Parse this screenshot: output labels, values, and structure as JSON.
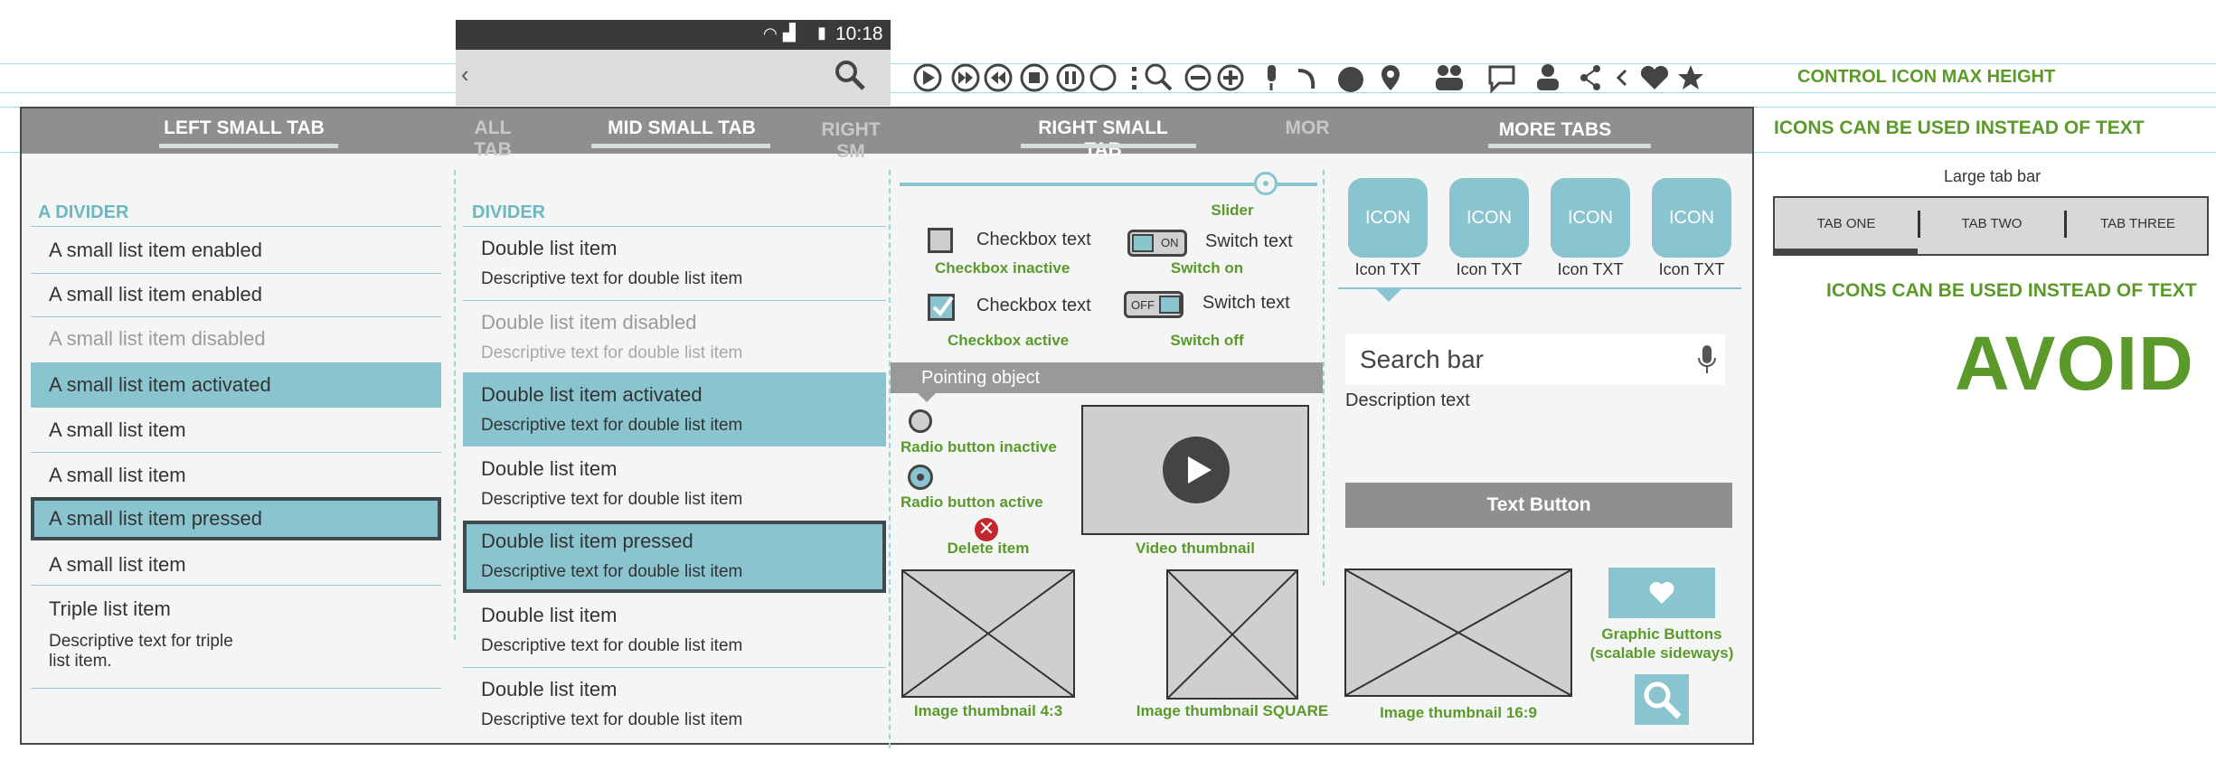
{
  "status_bar": {
    "time": "10:18"
  },
  "top_tabs": [
    {
      "label": "LEFT SMALL TAB"
    },
    {
      "label": "ALL TAB"
    },
    {
      "label": "MID SMALL TAB"
    },
    {
      "label": "RIGHT SM"
    },
    {
      "label": "RIGHT SMALL TAB"
    },
    {
      "label": "MOR"
    },
    {
      "label": "MORE TABS"
    }
  ],
  "notes": {
    "control_icon": "CONTROL ICON MAX HEIGHT",
    "icons_text_1": "ICONS CAN BE USED INSTEAD OF TEXT",
    "large_tab_bar": "Large tab bar",
    "icons_text_2": "ICONS CAN BE USED INSTEAD OF TEXT",
    "avoid": "AVOID"
  },
  "large_tabs": [
    {
      "label": "TAB ONE"
    },
    {
      "label": "TAB TWO"
    },
    {
      "label": "TAB THREE"
    }
  ],
  "left_list": {
    "divider": "A DIVIDER",
    "items": [
      {
        "label": "A small list item enabled"
      },
      {
        "label": "A small list item enabled"
      },
      {
        "label": "A small list item disabled"
      },
      {
        "label": "A small list item activated"
      },
      {
        "label": "A small list item"
      },
      {
        "label": "A small list item"
      },
      {
        "label": "A small list item pressed"
      },
      {
        "label": "A small list item"
      }
    ],
    "triple": {
      "title": "Triple list item",
      "desc1": "Descriptive text for triple",
      "desc2": "list item."
    }
  },
  "mid_list": {
    "divider": "DIVIDER",
    "items": [
      {
        "title": "Double list item",
        "desc": "Descriptive text for double list item"
      },
      {
        "title": "Double list item disabled",
        "desc": "Descriptive text for double list item"
      },
      {
        "title": "Double list item activated",
        "desc": "Descriptive text for double list item"
      },
      {
        "title": "Double list item",
        "desc": "Descriptive text for double list item"
      },
      {
        "title": "Double list item pressed",
        "desc": "Descriptive text for double list item"
      },
      {
        "title": "Double list item",
        "desc": "Descriptive text for double list item"
      },
      {
        "title": "Double list item",
        "desc": "Descriptive text for double list item"
      }
    ]
  },
  "controls": {
    "slider_label": "Slider",
    "slider_value": 0.9,
    "checkbox_text": "Checkbox text",
    "checkbox_inactive": "Checkbox inactive",
    "checkbox_active": "Checkbox active",
    "switch_text": "Switch text",
    "switch_on_badge": "ON",
    "switch_off_badge": "OFF",
    "switch_on": "Switch on",
    "switch_off": "Switch off",
    "pointing_object": "Pointing object",
    "radio_inactive": "Radio button inactive",
    "radio_active": "Radio button active",
    "delete_item": "Delete item",
    "video_thumbnail": "Video thumbnail",
    "img_43": "Image thumbnail 4:3",
    "img_square": "Image thumbnail SQUARE"
  },
  "right_panel": {
    "icon_tiles": [
      {
        "icon": "ICON",
        "label": "Icon TXT"
      },
      {
        "icon": "ICON",
        "label": "Icon TXT"
      },
      {
        "icon": "ICON",
        "label": "Icon TXT"
      },
      {
        "icon": "ICON",
        "label": "Icon TXT"
      }
    ],
    "search_placeholder": "Search bar",
    "description": "Description text",
    "text_button": "Text Button",
    "img_169": "Image thumbnail 16:9",
    "graphic_buttons_1": "Graphic Buttons",
    "graphic_buttons_2": "(scalable sideways)"
  },
  "colors": {
    "accent": "#8ac5cf",
    "green": "#5b9a2a",
    "tabbar": "#8f8f8f",
    "delete": "#c0282d"
  }
}
